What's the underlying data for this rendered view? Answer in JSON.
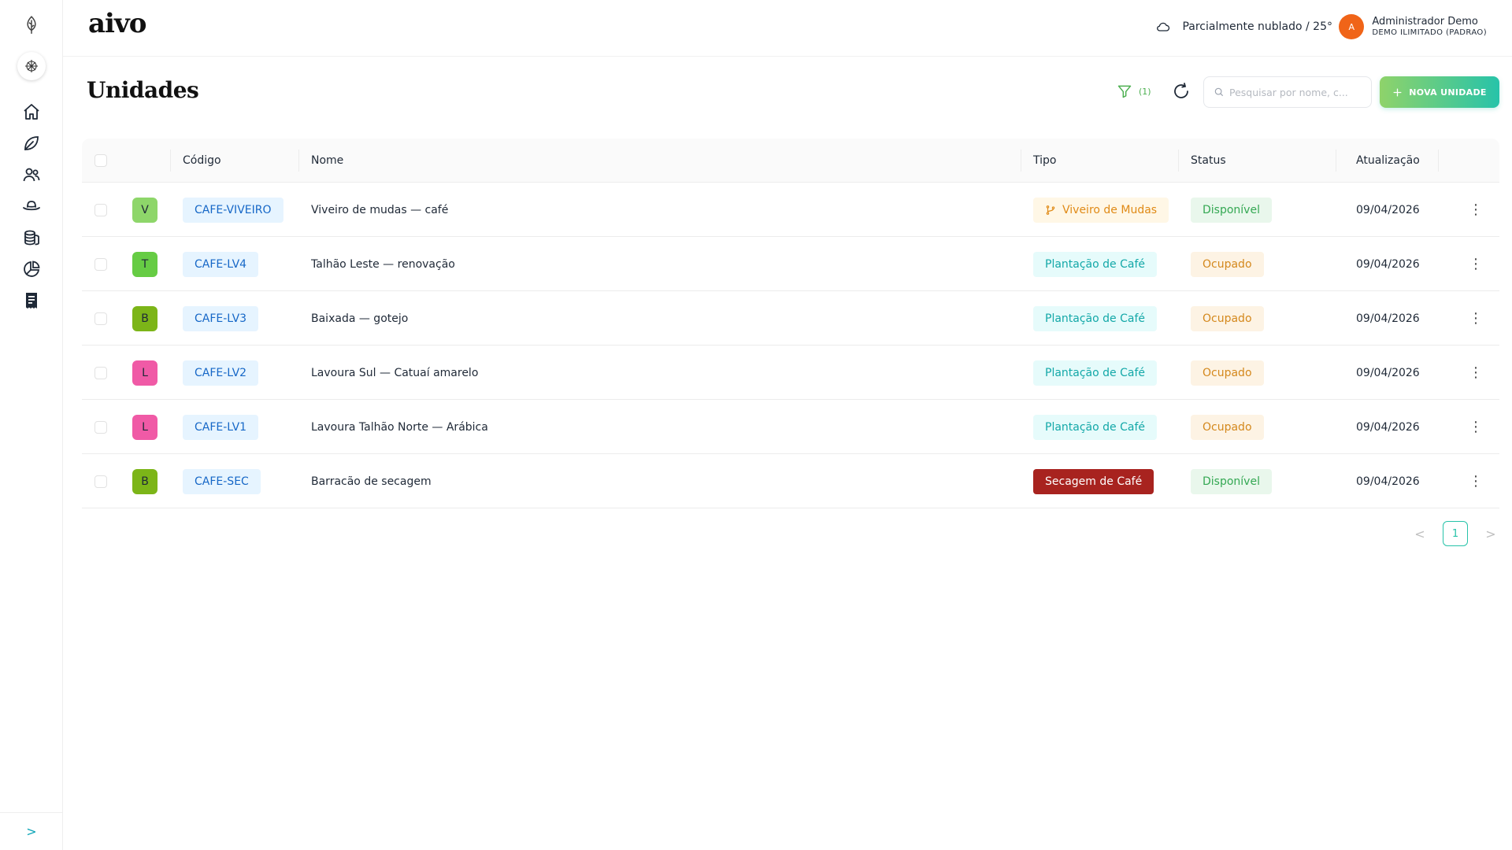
{
  "brand": "aivo",
  "header": {
    "weather_text": "Parcialmente nublado / 25°",
    "user_initial": "A",
    "user_name": "Administrador Demo",
    "user_plan": "DEMO ILIMITADO (PADRAO)"
  },
  "sidebar": {
    "items": [
      {
        "name": "home-icon"
      },
      {
        "name": "leaf-icon"
      },
      {
        "name": "users-icon"
      },
      {
        "name": "hat-icon"
      },
      {
        "name": "coins-icon"
      },
      {
        "name": "pie-chart-icon"
      },
      {
        "name": "receipt-icon"
      }
    ],
    "collapse_label": ">"
  },
  "page": {
    "title": "Unidades",
    "filter_count": "(1)",
    "search_placeholder": "Pesquisar por nome, c...",
    "new_button_label": "NOVA UNIDADE"
  },
  "table": {
    "columns": {
      "code": "Código",
      "name": "Nome",
      "type": "Tipo",
      "status": "Status",
      "updated": "Atualização"
    },
    "rows": [
      {
        "initial": "V",
        "avatar_color": "#8ed66a",
        "code": "CAFE-VIVEIRO",
        "name": "Viveiro de mudas — café",
        "type": "Viveiro de Mudas",
        "type_style": "orange",
        "status": "Disponível",
        "status_style": "green",
        "updated": "09/04/2026"
      },
      {
        "initial": "T",
        "avatar_color": "#66cc44",
        "code": "CAFE-LV4",
        "name": "Talhão Leste — renovação",
        "type": "Plantação de Café",
        "type_style": "cyan",
        "status": "Ocupado",
        "status_style": "orange",
        "updated": "09/04/2026"
      },
      {
        "initial": "B",
        "avatar_color": "#7cb518",
        "code": "CAFE-LV3",
        "name": "Baixada — gotejo",
        "type": "Plantação de Café",
        "type_style": "cyan",
        "status": "Ocupado",
        "status_style": "orange",
        "updated": "09/04/2026"
      },
      {
        "initial": "L",
        "avatar_color": "#f05aa6",
        "code": "CAFE-LV2",
        "name": "Lavoura Sul — Catuaí amarelo",
        "type": "Plantação de Café",
        "type_style": "cyan",
        "status": "Ocupado",
        "status_style": "orange",
        "updated": "09/04/2026"
      },
      {
        "initial": "L",
        "avatar_color": "#f05aa6",
        "code": "CAFE-LV1",
        "name": "Lavoura Talhão Norte — Arábica",
        "type": "Plantação de Café",
        "type_style": "cyan",
        "status": "Ocupado",
        "status_style": "orange",
        "updated": "09/04/2026"
      },
      {
        "initial": "B",
        "avatar_color": "#7cb518",
        "code": "CAFE-SEC",
        "name": "Barracão de secagem",
        "type": "Secagem de Café",
        "type_style": "red",
        "status": "Disponível",
        "status_style": "green",
        "updated": "09/04/2026"
      }
    ]
  },
  "pagination": {
    "current_page": "1",
    "prev": "<",
    "next": ">"
  }
}
